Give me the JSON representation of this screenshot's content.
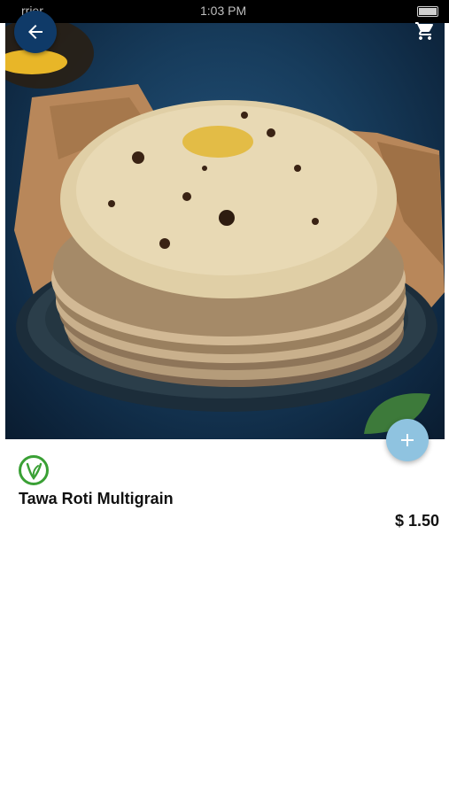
{
  "status_bar": {
    "carrier": "rrier",
    "time": "1:03 PM"
  },
  "header": {
    "back_icon": "arrow-left-icon",
    "cart_icon": "shopping-cart-icon"
  },
  "product": {
    "image_subject": "stack of tawa roti on a plate",
    "veg_icon": "vegetarian-leaf-icon",
    "name": "Tawa Roti Multigrain",
    "price": "$ 1.50",
    "add_icon": "plus-icon"
  },
  "colors": {
    "back_button_bg": "#0f3a68",
    "add_button_bg": "#8fc3e0",
    "veg_green": "#3aa035",
    "text": "#111111"
  }
}
